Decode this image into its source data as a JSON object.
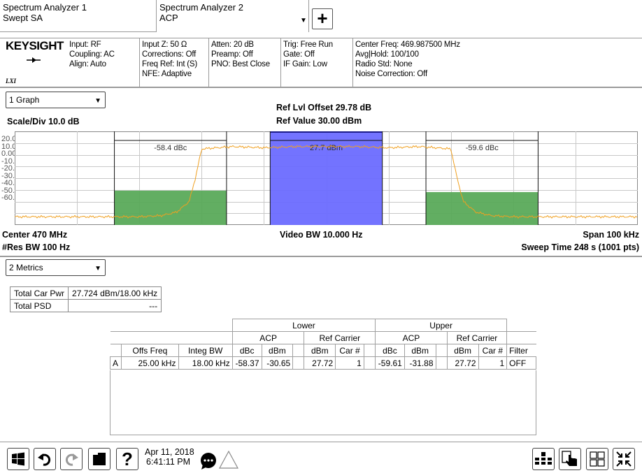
{
  "tabs": [
    {
      "line1": "Spectrum Analyzer 1",
      "line2": "Swept SA"
    },
    {
      "line1": "Spectrum Analyzer 2",
      "line2": "ACP"
    }
  ],
  "status": {
    "brand": "KEYSIGHT",
    "lxi": "LXI",
    "col1": [
      "Input: RF",
      "Coupling: AC",
      "Align: Auto"
    ],
    "col2": [
      "Input Z: 50 Ω",
      "Corrections: Off",
      "Freq Ref: Int (S)",
      "NFE: Adaptive"
    ],
    "col3": [
      "Atten: 20 dB",
      "Preamp: Off",
      "PNO: Best Close"
    ],
    "col4": [
      "Trig: Free Run",
      "Gate: Off",
      "IF Gain: Low"
    ],
    "col5": [
      "Center Freq: 469.987500 MHz",
      "Avg|Hold: 100/100",
      "Radio Std: None",
      "Noise Correction: Off"
    ]
  },
  "graph": {
    "dropdown": "1 Graph",
    "scale_div": "Scale/Div 10.0 dB",
    "ref_offset": "Ref Lvl Offset 29.78 dB",
    "ref_value": "Ref Value 30.00 dBm",
    "y_ticks": [
      "20.0",
      "10.0",
      "0.00",
      "-10.0",
      "-20.0",
      "-30.0",
      "-40.0",
      "-50.0",
      "-60.0"
    ],
    "center": "Center 470 MHz",
    "res_bw": "#Res BW 100 Hz",
    "video_bw": "Video BW 10.000 Hz",
    "span": "Span 100 kHz",
    "sweep": "Sweep Time 248 s (1001 pts)",
    "lower_label": "-58.4 dBc",
    "carrier_label": "27.7 dBm",
    "upper_label": "-59.6 dBc",
    "colors": {
      "carrier": "#6b6bff",
      "adjacent": "#5aaa5a",
      "trace": "#f0a020"
    }
  },
  "chart_data": {
    "type": "line",
    "ylim": [
      -60,
      20
    ],
    "xlim": [
      469.95,
      470.05
    ],
    "xunit": "MHz",
    "yunit": "dBm",
    "trace": {
      "x": [
        469.95,
        469.96,
        469.965,
        469.97,
        469.9735,
        469.976,
        469.978,
        469.979,
        469.98,
        469.985,
        469.99,
        469.995,
        470.0,
        470.005,
        470.01,
        470.015,
        470.02,
        470.021,
        470.022,
        470.024,
        470.0265,
        470.03,
        470.035,
        470.04,
        470.05
      ],
      "y": [
        -53,
        -53,
        -53,
        -53,
        -52,
        -49,
        -40,
        -20,
        5,
        7,
        6,
        7,
        7,
        7,
        6,
        7,
        5,
        -20,
        -40,
        -49,
        -52,
        -53,
        -53,
        -53,
        -53
      ]
    },
    "channels": [
      {
        "name": "lower",
        "x_range": [
          469.966,
          469.984
        ],
        "top": -30.65,
        "label": "-58.4 dBc"
      },
      {
        "name": "carrier",
        "x_range": [
          469.991,
          470.009
        ],
        "top": 27.72,
        "label": "27.7 dBm"
      },
      {
        "name": "upper",
        "x_range": [
          470.016,
          470.034
        ],
        "top": -31.88,
        "label": "-59.6 dBc"
      }
    ]
  },
  "metrics": {
    "dropdown": "2 Metrics",
    "summary": [
      {
        "label": "Total Car Pwr",
        "value": "27.724 dBm/18.00 kHz"
      },
      {
        "label": "Total PSD",
        "value": "---"
      }
    ],
    "table": {
      "lower": "Lower",
      "upper": "Upper",
      "acp": "ACP",
      "ref_carrier": "Ref Carrier",
      "cols": [
        "Offs Freq",
        "Integ BW",
        "dBc",
        "dBm",
        "dBm",
        "Car #",
        "dBc",
        "dBm",
        "dBm",
        "Car #",
        "Filter"
      ],
      "rows": [
        {
          "id": "A",
          "offs": "25.00 kHz",
          "bw": "18.00 kHz",
          "l_dbc": "-58.37",
          "l_dbm": "-30.65",
          "l_ref_dbm": "27.72",
          "l_car": "1",
          "u_dbc": "-59.61",
          "u_dbm": "-31.88",
          "u_ref_dbm": "27.72",
          "u_car": "1",
          "filter": "OFF"
        }
      ]
    }
  },
  "taskbar": {
    "date": "Apr 11, 2018",
    "time": "6:41:11 PM"
  }
}
